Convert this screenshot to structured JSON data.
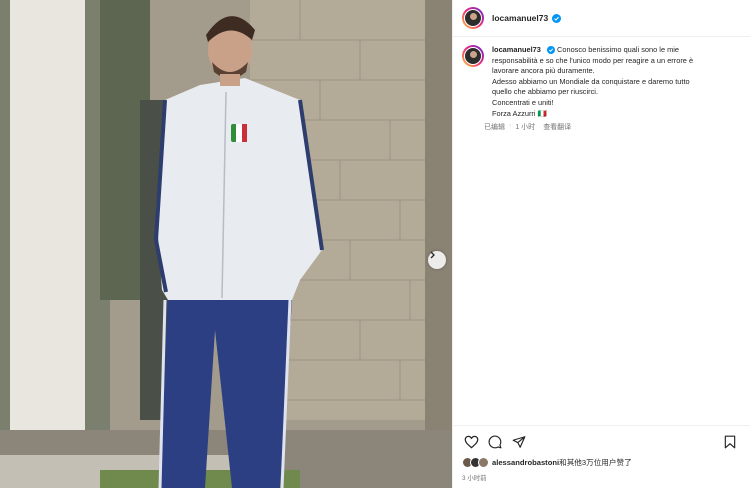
{
  "post": {
    "username": "locamanuel73",
    "caption_lines": [
      "Conosco benissimo quali sono le mie",
      "responsabilità e so che l'unico modo per reagire a un errore è",
      "lavorare ancora più duramente.",
      "Adesso abbiamo un Mondiale da conquistare e daremo tutto",
      "quello che abbiamo per riuscirci.",
      "Concentrati e uniti!",
      "Forza Azzurri 🇮🇹"
    ],
    "edited_label": "已编辑",
    "separator": "·",
    "time": "1 小时",
    "translate_label": "查看翻译",
    "likes_user": "alessandrobastoni",
    "likes_rest": "和其他3万位用户赞了",
    "posted_ago": "3 小时前"
  },
  "colors": {
    "verified": "#0095f6",
    "text": "#262626",
    "secondary": "#737373",
    "divider": "#efefef"
  },
  "icons": [
    "heart-icon",
    "comment-icon",
    "share-icon",
    "bookmark-icon",
    "chevron-right-icon",
    "verified-badge-icon"
  ]
}
